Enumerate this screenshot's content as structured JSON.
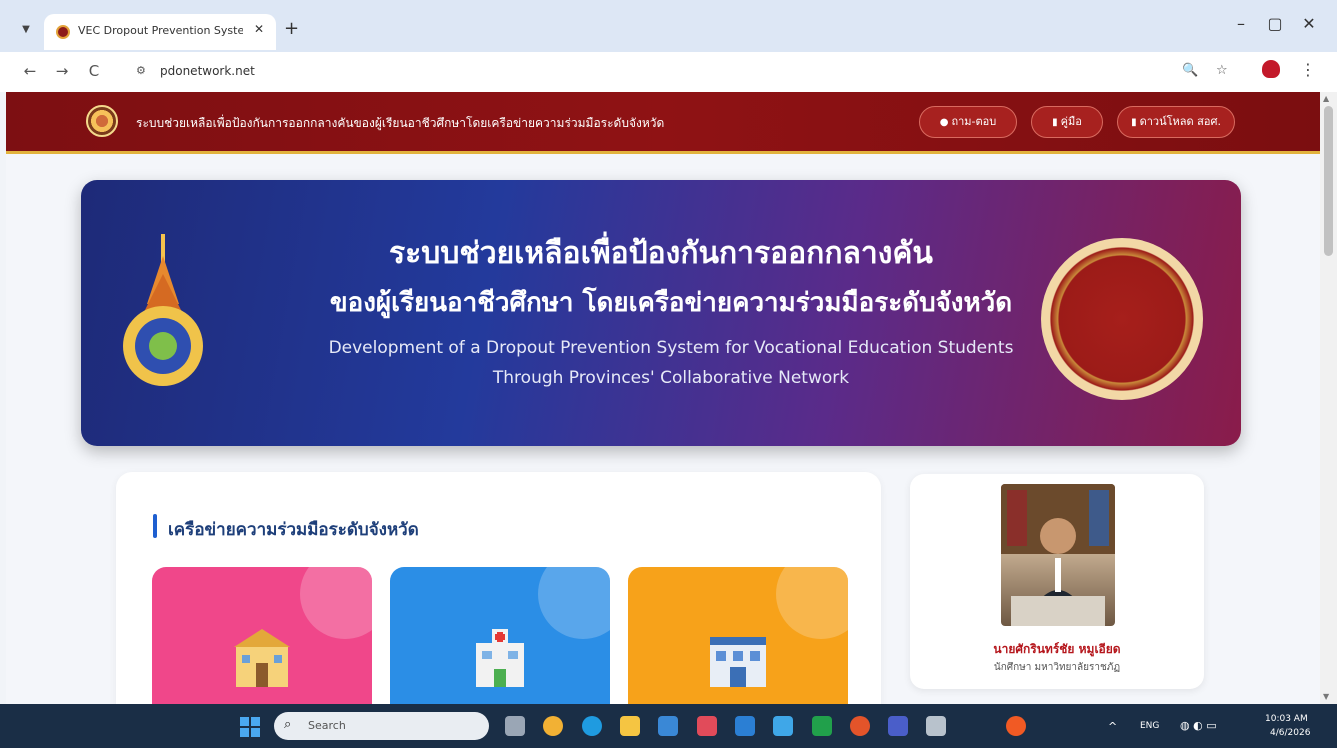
{
  "browser": {
    "tab_title": "VEC Dropout Prevention Syste",
    "tab_close": "✕",
    "new_tab": "+",
    "url": "pdonetwork.net",
    "window_controls": {
      "minimize": "–",
      "restore": "▢",
      "close": "✕"
    },
    "nav": {
      "back": "←",
      "forward": "→",
      "reload": "C"
    }
  },
  "site_header": {
    "title": "ระบบช่วยเหลือเพื่อป้องกันการออกกลางคันของผู้เรียนอาชีวศึกษาโดยเครือข่ายความร่วมมือระดับจังหวัด",
    "buttons": [
      {
        "label": "ถาม-ตอบ",
        "icon": "chat-icon"
      },
      {
        "label": "คู่มือ",
        "icon": "document-icon"
      },
      {
        "label": "ดาวน์โหลด สอศ.",
        "icon": "document-icon"
      }
    ]
  },
  "hero": {
    "line1": "ระบบช่วยเหลือเพื่อป้องกันการออกกลางคัน",
    "line2": "ของผู้เรียนอาชีวศึกษา โดยเครือข่ายความร่วมมือระดับจังหวัด",
    "en_line1": "Development of a Dropout Prevention System for Vocational Education Students",
    "en_line2": "Through Provinces' Collaborative Network"
  },
  "network": {
    "title": "เครือข่ายความร่วมมือระดับจังหวัด",
    "tiles": [
      {
        "icon": "school-building-icon",
        "color": "#f0478a"
      },
      {
        "icon": "hospital-icon",
        "color": "#2b8ee6"
      },
      {
        "icon": "office-building-icon",
        "color": "#f7a21a"
      }
    ]
  },
  "profile": {
    "name": "นายศักรินทร์ชัย หมูเอียด",
    "role": "นักศึกษา มหาวิทยาลัยราชภัฏ"
  },
  "taskbar": {
    "search_placeholder": "Search",
    "lang": "ENG",
    "time": "10:03 AM",
    "date": "4/6/2026"
  }
}
